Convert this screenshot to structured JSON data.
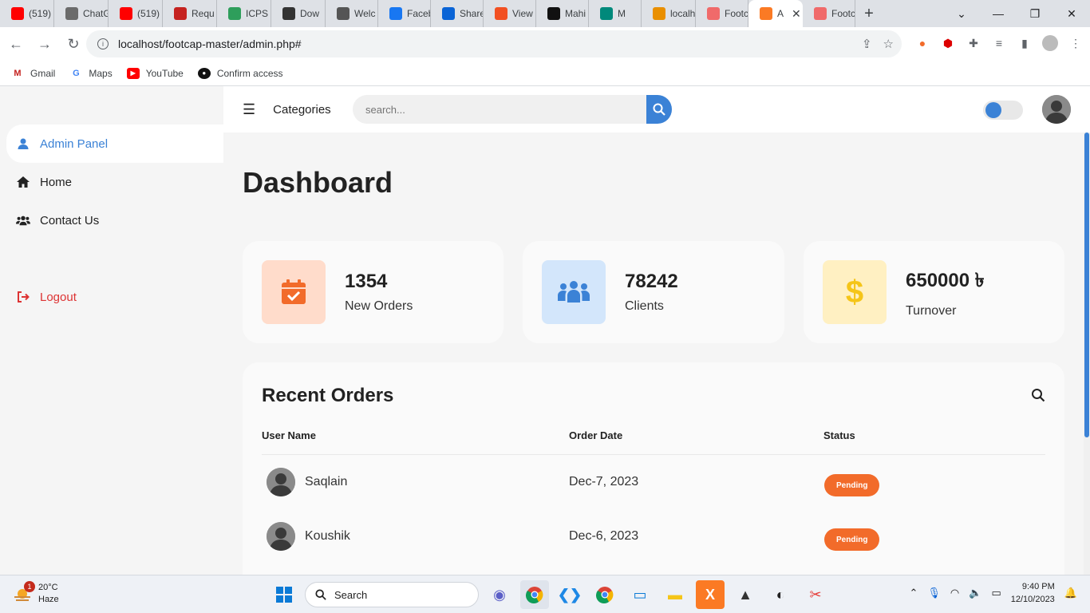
{
  "browser": {
    "tabs": [
      {
        "label": "(519)",
        "icon": "youtube-icon",
        "color": "#ff0000"
      },
      {
        "label": "ChatG",
        "icon": "chatgpt-icon",
        "color": "#6b6b6b"
      },
      {
        "label": "(519)",
        "icon": "youtube-icon",
        "color": "#ff0000"
      },
      {
        "label": "Requ",
        "icon": "gmail-icon",
        "color": "#c5221f"
      },
      {
        "label": "ICPS",
        "icon": "icps-icon",
        "color": "#2e9e5b"
      },
      {
        "label": "Dow",
        "icon": "download-icon",
        "color": "#333333"
      },
      {
        "label": "Welc",
        "icon": "globe-icon",
        "color": "#555555"
      },
      {
        "label": "Faceb",
        "icon": "facebook-icon",
        "color": "#1877f2"
      },
      {
        "label": "Share",
        "icon": "onedrive-icon",
        "color": "#0a64d6"
      },
      {
        "label": "View",
        "icon": "microsoft-icon",
        "color": "#f25022"
      },
      {
        "label": "Mahi",
        "icon": "github-icon",
        "color": "#111111"
      },
      {
        "label": "M",
        "icon": "meet-icon",
        "color": "#00897b"
      },
      {
        "label": "localh",
        "icon": "phpmyadmin-icon",
        "color": "#e98f00"
      },
      {
        "label": "Footc",
        "icon": "footcap-icon",
        "color": "#f06a6a"
      },
      {
        "label": "A",
        "icon": "xampp-icon",
        "color": "#fb7a24"
      },
      {
        "label": "Footc",
        "icon": "footcap-icon",
        "color": "#f06a6a"
      }
    ],
    "url": "localhost/footcap-master/admin.php#",
    "bookmarks": [
      {
        "label": "Gmail",
        "icon": "gmail-icon"
      },
      {
        "label": "Maps",
        "icon": "google-icon"
      },
      {
        "label": "YouTube",
        "icon": "youtube-icon"
      },
      {
        "label": "Confirm access",
        "icon": "github-icon"
      }
    ]
  },
  "sidebar": {
    "items": [
      {
        "label": "Admin Panel",
        "icon": "user-icon"
      },
      {
        "label": "Home",
        "icon": "home-icon"
      },
      {
        "label": "Contact Us",
        "icon": "users-icon"
      }
    ],
    "logout_label": "Logout"
  },
  "topnav": {
    "categories_label": "Categories",
    "search_placeholder": "search..."
  },
  "dashboard": {
    "title": "Dashboard",
    "cards": [
      {
        "value": "1354",
        "label": "New Orders",
        "icon": "calendar-check-icon",
        "bg": "#ffdccb",
        "fg": "#f26b2a"
      },
      {
        "value": "78242",
        "label": "Clients",
        "icon": "people-group-icon",
        "bg": "#d3e6fb",
        "fg": "#3b82d6"
      },
      {
        "value": "650000 ৳",
        "label": "Turnover",
        "icon": "dollar-icon",
        "bg": "#fff0c2",
        "fg": "#f5c518"
      }
    ],
    "recent_orders": {
      "title": "Recent Orders",
      "columns": [
        "User Name",
        "Order Date",
        "Status"
      ],
      "rows": [
        {
          "name": "Saqlain",
          "date": "Dec-7, 2023",
          "status": "Pending"
        },
        {
          "name": "Koushik",
          "date": "Dec-6, 2023",
          "status": "Pending"
        }
      ]
    }
  },
  "taskbar": {
    "weather_temp": "20°C",
    "weather_desc": "Haze",
    "weather_badge": "1",
    "search_label": "Search",
    "time": "9:40 PM",
    "date": "12/10/2023"
  },
  "colors": {
    "accent": "#3b82d6",
    "pending": "#f26b2a",
    "logout": "#dd3333"
  }
}
